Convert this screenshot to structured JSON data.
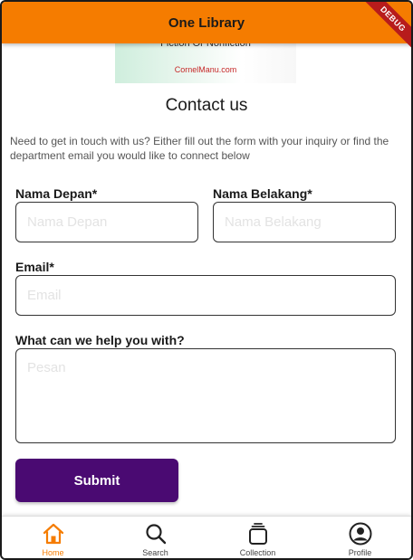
{
  "app_bar": {
    "title": "One Library",
    "debug_label": "DEBUG"
  },
  "banner": {
    "title": "Fiction Or Nonfiction",
    "credit": "CornelManu.com"
  },
  "heading": "Contact us",
  "intro": "Need to get in touch with us? Either fill out the form with your inquiry or find the department email you would like to connect below",
  "form": {
    "first_name": {
      "label": "Nama Depan*",
      "placeholder": "Nama Depan",
      "value": ""
    },
    "last_name": {
      "label": "Nama Belakang*",
      "placeholder": "Nama Belakang",
      "value": ""
    },
    "email": {
      "label": "Email*",
      "placeholder": "Email",
      "value": ""
    },
    "message": {
      "label": "What can we help you with?",
      "placeholder": "Pesan",
      "value": ""
    },
    "submit_label": "Submit"
  },
  "bottom_nav": {
    "active": "Home",
    "items": [
      {
        "label": "Home",
        "icon": "home-icon"
      },
      {
        "label": "Search",
        "icon": "search-icon"
      },
      {
        "label": "Collection",
        "icon": "collection-icon"
      },
      {
        "label": "Profile",
        "icon": "profile-icon"
      }
    ]
  },
  "colors": {
    "accent": "#f57c00",
    "primary_button": "#4a0a72",
    "debug": "#b71c1c"
  }
}
